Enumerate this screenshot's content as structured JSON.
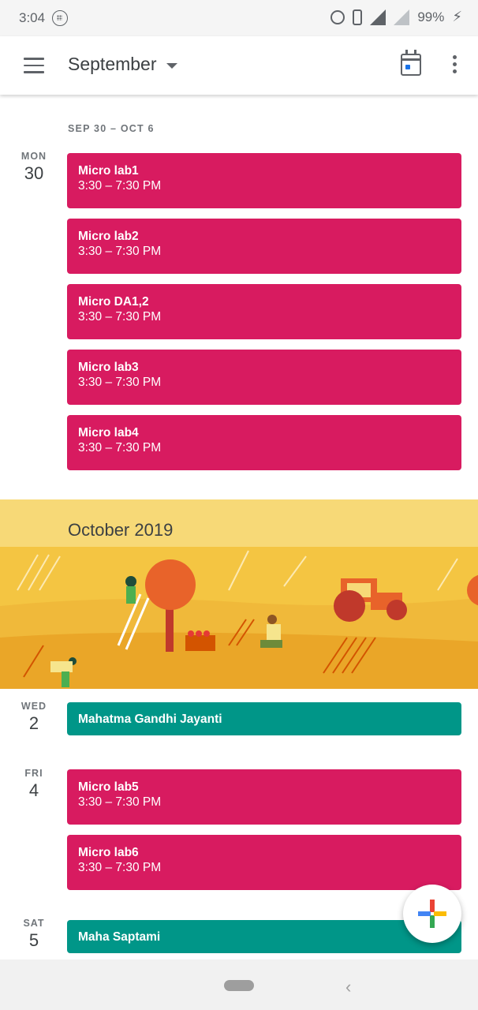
{
  "status_bar": {
    "time": "3:04",
    "battery": "99%"
  },
  "app_bar": {
    "month": "September"
  },
  "week_range": "SEP 30 – OCT 6",
  "days": [
    {
      "dow": "MON",
      "num": "30"
    },
    {
      "dow": "WED",
      "num": "2"
    },
    {
      "dow": "FRI",
      "num": "4"
    },
    {
      "dow": "SAT",
      "num": "5"
    }
  ],
  "events": [
    {
      "title": "Micro lab1",
      "time": "3:30 – 7:30 PM"
    },
    {
      "title": "Micro lab2",
      "time": "3:30 – 7:30 PM"
    },
    {
      "title": "Micro DA1,2",
      "time": "3:30 – 7:30 PM"
    },
    {
      "title": "Micro lab3",
      "time": "3:30 – 7:30 PM"
    },
    {
      "title": "Micro lab4",
      "time": "3:30 – 7:30 PM"
    },
    {
      "title": "Mahatma Gandhi Jayanti"
    },
    {
      "title": "Micro lab5",
      "time": "3:30 – 7:30 PM"
    },
    {
      "title": "Micro lab6",
      "time": "3:30 – 7:30 PM"
    },
    {
      "title": "Maha Saptami"
    }
  ],
  "month_banner": {
    "label": "October 2019"
  },
  "colors": {
    "event_pink": "#d81b60",
    "event_teal": "#009688",
    "banner": "#f7d977"
  },
  "icons": [
    "menu-icon",
    "dropdown-caret-icon",
    "today-calendar-icon",
    "more-vert-icon",
    "add-icon",
    "alarm-icon",
    "vibrate-icon",
    "signal-icon",
    "battery-charging-icon"
  ]
}
